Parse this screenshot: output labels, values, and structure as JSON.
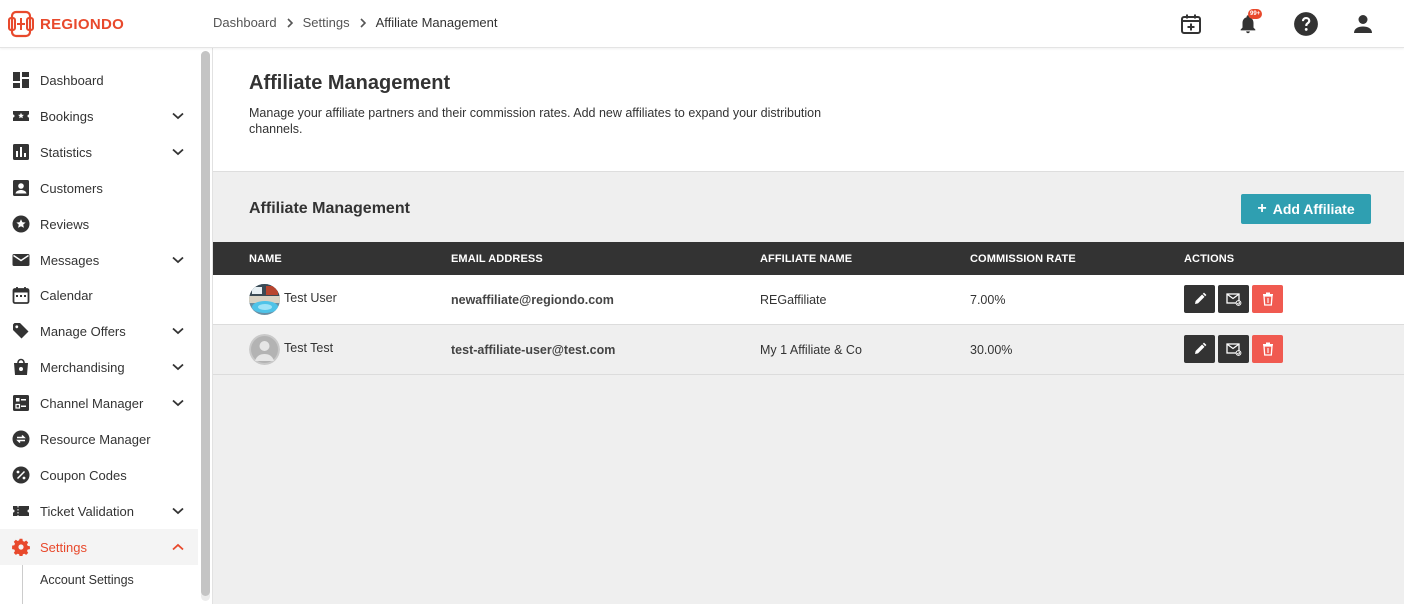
{
  "app": {
    "logo_text": "REGIONDO"
  },
  "breadcrumb": [
    "Dashboard",
    "Settings",
    "Affiliate Management"
  ],
  "header_icons": [
    "calendar-add-icon",
    "bell-icon",
    "help-icon",
    "user-icon"
  ],
  "notifications": {
    "badge": "99+"
  },
  "sidebar": {
    "items": [
      {
        "label": "Dashboard",
        "icon": "dashboard-icon",
        "expandable": false
      },
      {
        "label": "Bookings",
        "icon": "ticket-star-icon",
        "expandable": true
      },
      {
        "label": "Statistics",
        "icon": "bar-chart-icon",
        "expandable": true
      },
      {
        "label": "Customers",
        "icon": "person-box-icon",
        "expandable": false
      },
      {
        "label": "Reviews",
        "icon": "star-circle-icon",
        "expandable": false
      },
      {
        "label": "Messages",
        "icon": "mail-icon",
        "expandable": true
      },
      {
        "label": "Calendar",
        "icon": "calendar-icon",
        "expandable": false
      },
      {
        "label": "Manage Offers",
        "icon": "tag-icon",
        "expandable": true
      },
      {
        "label": "Merchandising",
        "icon": "shopping-bag-icon",
        "expandable": true
      },
      {
        "label": "Channel Manager",
        "icon": "checklist-icon",
        "expandable": true
      },
      {
        "label": "Resource Manager",
        "icon": "swap-circle-icon",
        "expandable": false
      },
      {
        "label": "Coupon Codes",
        "icon": "percent-icon",
        "expandable": false
      },
      {
        "label": "Ticket Validation",
        "icon": "ticket-icon",
        "expandable": true
      },
      {
        "label": "Settings",
        "icon": "gear-icon",
        "expandable": true,
        "active": true
      }
    ],
    "sub_items": [
      {
        "label": "Account Settings"
      }
    ]
  },
  "page": {
    "title": "Affiliate Management",
    "description": "Manage your affiliate partners and their commission rates. Add new affiliates to expand your distribution channels.",
    "section_title": "Affiliate Management",
    "add_button": "Add Affiliate"
  },
  "table": {
    "columns": [
      "NAME",
      "EMAIL ADDRESS",
      "AFFILIATE NAME",
      "COMMISSION RATE",
      "ACTIONS"
    ],
    "rows": [
      {
        "name": "Test User",
        "email": "newaffiliate@regiondo.com",
        "affiliate_name": "REGaffiliate",
        "commission_rate": "7.00%",
        "avatar": "photo"
      },
      {
        "name": "Test Test",
        "email": "test-affiliate-user@test.com",
        "affiliate_name": "My 1 Affiliate & Co",
        "commission_rate": "30.00%",
        "avatar": "placeholder"
      }
    ],
    "actions": [
      "edit-icon",
      "resend-mail-icon",
      "delete-icon"
    ]
  },
  "colors": {
    "brand": "#e8492c",
    "accent": "#2f9fb1",
    "table_header": "#333333",
    "danger": "#f05a50"
  }
}
